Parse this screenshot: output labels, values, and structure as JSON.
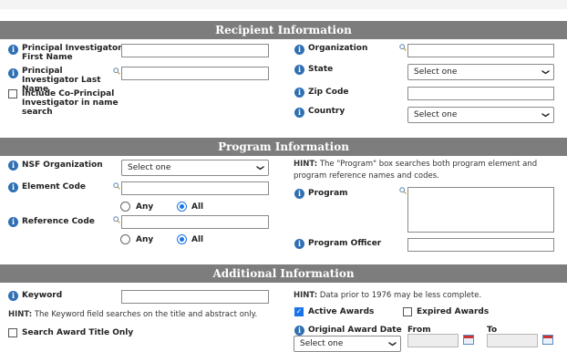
{
  "recipient": {
    "title": "Recipient Information",
    "pi_first_name": "Principal Investigator First Name",
    "pi_last_name": "Principal Investigator Last Name",
    "include_co_pi": "Include Co-Principal Investigator in name search",
    "organization": "Organization",
    "state": "State",
    "state_value": "Select one",
    "zip": "Zip Code",
    "country": "Country",
    "country_value": "Select one"
  },
  "program": {
    "title": "Program Information",
    "nsf_org": "NSF Organization",
    "nsf_org_value": "Select one",
    "element_code": "Element Code",
    "reference_code": "Reference Code",
    "any": "Any",
    "all": "All",
    "hint_label": "HINT:",
    "hint_text": "The \"Program\" box searches both program element and program reference names and codes.",
    "program": "Program",
    "program_officer": "Program Officer"
  },
  "additional": {
    "title": "Additional Information",
    "keyword": "Keyword",
    "hint_label": "HINT:",
    "keyword_hint": "The Keyword field searches on the title and abstract only.",
    "search_title_only": "Search Award Title Only",
    "date_hint": "Data prior to 1976 may be less complete.",
    "active_awards": "Active Awards",
    "expired_awards": "Expired Awards",
    "original_award_date": "Original Award Date",
    "from": "From",
    "to": "To",
    "date_select_value": "Select one"
  },
  "icons": {
    "info": "info-icon",
    "search": "search-icon",
    "calendar": "calendar-icon",
    "chevron": "chevron-down-icon"
  },
  "colors": {
    "header": "#7d7d7d",
    "accent": "#1a73e8",
    "info": "#2f6fb3"
  }
}
